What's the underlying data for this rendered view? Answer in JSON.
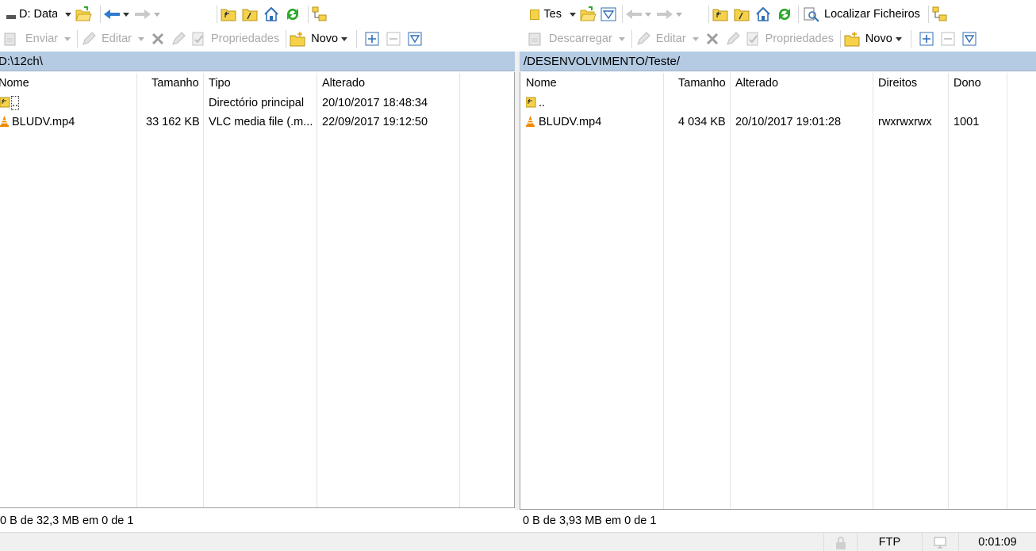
{
  "left_toolbar": {
    "drive_label": "D: Data",
    "upload_label": "Enviar",
    "edit_label": "Editar",
    "properties_label": "Propriedades",
    "new_label": "Novo"
  },
  "right_toolbar": {
    "site_label": "Tes",
    "find_files_label": "Localizar Ficheiros",
    "download_label": "Descarregar",
    "edit_label": "Editar",
    "properties_label": "Propriedades",
    "new_label": "Novo"
  },
  "left_panel": {
    "path": "D:\\12ch\\",
    "columns": [
      "Nome",
      "Tamanho",
      "Tipo",
      "Alterado"
    ],
    "rows": [
      {
        "name": "..",
        "size": "",
        "type": "Directório principal",
        "modified": "20/10/2017  18:48:34"
      },
      {
        "name": "BLUDV.mp4",
        "size": "33 162 KB",
        "type": "VLC media file (.m...",
        "modified": "22/09/2017  19:12:50"
      }
    ],
    "status": "0 B de 32,3 MB em 0 de 1"
  },
  "right_panel": {
    "path": "/DESENVOLVIMENTO/Teste/",
    "columns": [
      "Nome",
      "Tamanho",
      "Alterado",
      "Direitos",
      "Dono"
    ],
    "rows": [
      {
        "name": "..",
        "size": "",
        "modified": "",
        "rights": "",
        "owner": ""
      },
      {
        "name": "BLUDV.mp4",
        "size": "4 034 KB",
        "modified": "20/10/2017 19:01:28",
        "rights": "rwxrwxrwx",
        "owner": "1001"
      }
    ],
    "status": "0 B de 3,93 MB em 0 de 1"
  },
  "statusbar": {
    "protocol": "FTP",
    "elapsed": "0:01:09"
  },
  "colors": {
    "path_bar": "#b4cbe3",
    "folder_yellow": "#f5d24a",
    "refresh_green": "#2eaa2e",
    "nav_blue": "#2f7bd1",
    "vlc_orange": "#f08a00"
  }
}
